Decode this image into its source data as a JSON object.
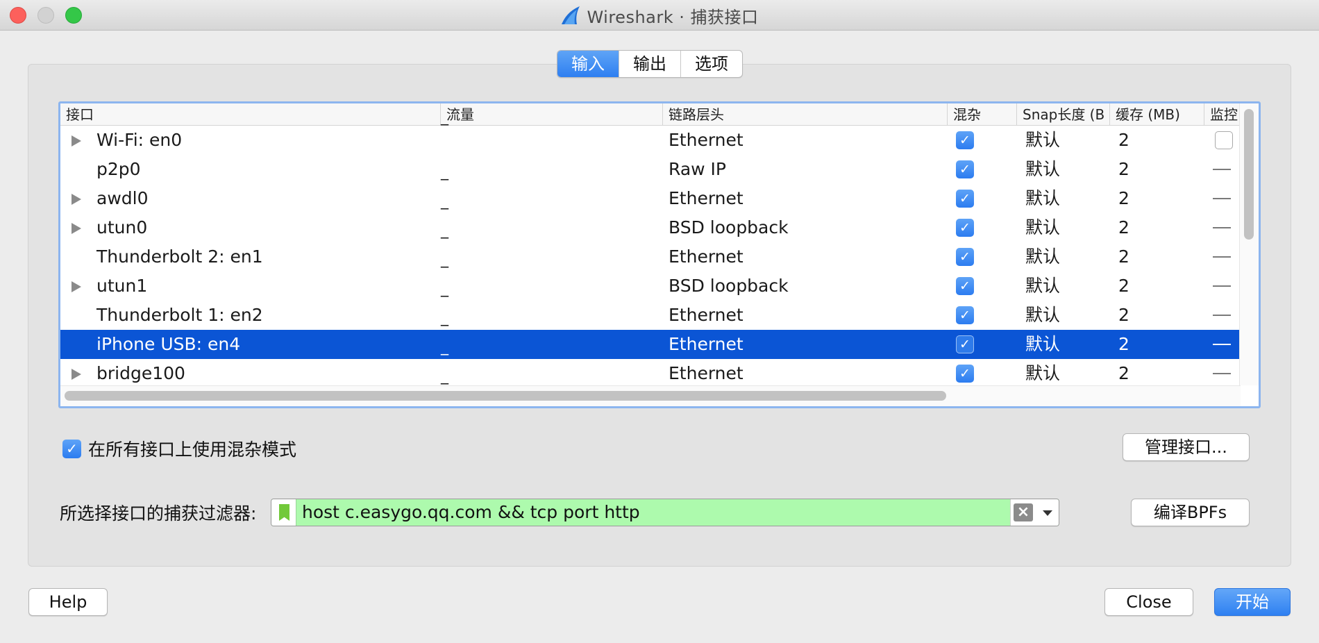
{
  "window": {
    "title": "Wireshark · 捕获接口"
  },
  "tabs": [
    {
      "label": "输入",
      "active": true
    },
    {
      "label": "输出",
      "active": false
    },
    {
      "label": "选项",
      "active": false
    }
  ],
  "table": {
    "columns": [
      "接口",
      "流量",
      "链路层头",
      "混杂",
      "Snap长度 (B",
      "缓存 (MB)",
      "监控"
    ],
    "rows": [
      {
        "name": "Wi-Fi: en0",
        "traffic": "‾",
        "link": "Ethernet",
        "promisc": true,
        "snap": "默认",
        "buffer": "2",
        "monitor": "checkbox",
        "expandable": true
      },
      {
        "name": "p2p0",
        "traffic": "_",
        "link": "Raw IP",
        "promisc": true,
        "snap": "默认",
        "buffer": "2",
        "monitor": "—",
        "expandable": false
      },
      {
        "name": "awdl0",
        "traffic": "_",
        "link": "Ethernet",
        "promisc": true,
        "snap": "默认",
        "buffer": "2",
        "monitor": "—",
        "expandable": true
      },
      {
        "name": "utun0",
        "traffic": "_",
        "link": "BSD loopback",
        "promisc": true,
        "snap": "默认",
        "buffer": "2",
        "monitor": "—",
        "expandable": true
      },
      {
        "name": "Thunderbolt 2: en1",
        "traffic": "_",
        "link": "Ethernet",
        "promisc": true,
        "snap": "默认",
        "buffer": "2",
        "monitor": "—",
        "expandable": false
      },
      {
        "name": "utun1",
        "traffic": "_",
        "link": "BSD loopback",
        "promisc": true,
        "snap": "默认",
        "buffer": "2",
        "monitor": "—",
        "expandable": true
      },
      {
        "name": "Thunderbolt 1: en2",
        "traffic": "_",
        "link": "Ethernet",
        "promisc": true,
        "snap": "默认",
        "buffer": "2",
        "monitor": "—",
        "expandable": false
      },
      {
        "name": "iPhone USB: en4",
        "traffic": "_",
        "link": "Ethernet",
        "promisc": true,
        "snap": "默认",
        "buffer": "2",
        "monitor": "—",
        "expandable": false,
        "selected": true
      },
      {
        "name": "bridge100",
        "traffic": "_",
        "link": "Ethernet",
        "promisc": true,
        "snap": "默认",
        "buffer": "2",
        "monitor": "—",
        "expandable": true
      }
    ]
  },
  "promiscuous_all": {
    "checked": true,
    "label": "在所有接口上使用混杂模式"
  },
  "buttons": {
    "manage": "管理接口...",
    "compile_bpf": "编译BPFs",
    "help": "Help",
    "close": "Close",
    "start": "开始"
  },
  "filter": {
    "label": "所选择接口的捕获过滤器:",
    "value": "host c.easygo.qq.com && tcp port http",
    "valid_color": "#adfaad"
  },
  "colors": {
    "accent": "#2e7ff1",
    "selection": "#0b55d5"
  },
  "icons": {
    "app": "wireshark-fin-icon",
    "bookmark": "bookmark-icon",
    "clear": "clear-x-icon",
    "dropdown": "chevron-down-icon"
  }
}
